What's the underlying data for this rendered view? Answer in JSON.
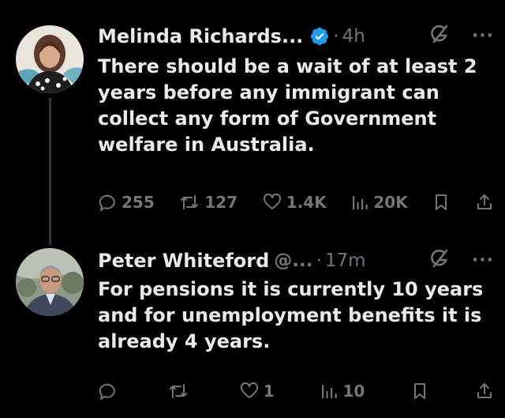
{
  "colors": {
    "background": "#000000",
    "text_primary": "#e7e9ea",
    "text_secondary": "#71767b",
    "verified_blue": "#1d9bf0",
    "thread_line": "#333639"
  },
  "tweets": [
    {
      "author_name": "Melinda Richards...",
      "verified": true,
      "separator": "·",
      "time": "4h",
      "text": "There should be a wait of at least 2 years before any immigrant can collect any form of Government welfare in Australia.",
      "stats": {
        "replies": "255",
        "reposts": "127",
        "likes": "1.4K",
        "views": "20K"
      },
      "icons": [
        "grok-icon",
        "more-icon",
        "reply-icon",
        "repost-icon",
        "like-icon",
        "views-icon",
        "bookmark-icon",
        "share-icon"
      ]
    },
    {
      "author_name": "Peter Whiteford",
      "handle": "@...",
      "separator": "·",
      "time": "17m",
      "text": "For pensions it is currently 10 years and for unemployment benefits it is already 4 years.",
      "stats": {
        "replies": "",
        "reposts": "",
        "likes": "1",
        "views": "10"
      },
      "icons": [
        "grok-icon",
        "more-icon",
        "reply-icon",
        "repost-icon",
        "like-icon",
        "views-icon",
        "bookmark-icon",
        "share-icon"
      ]
    }
  ]
}
